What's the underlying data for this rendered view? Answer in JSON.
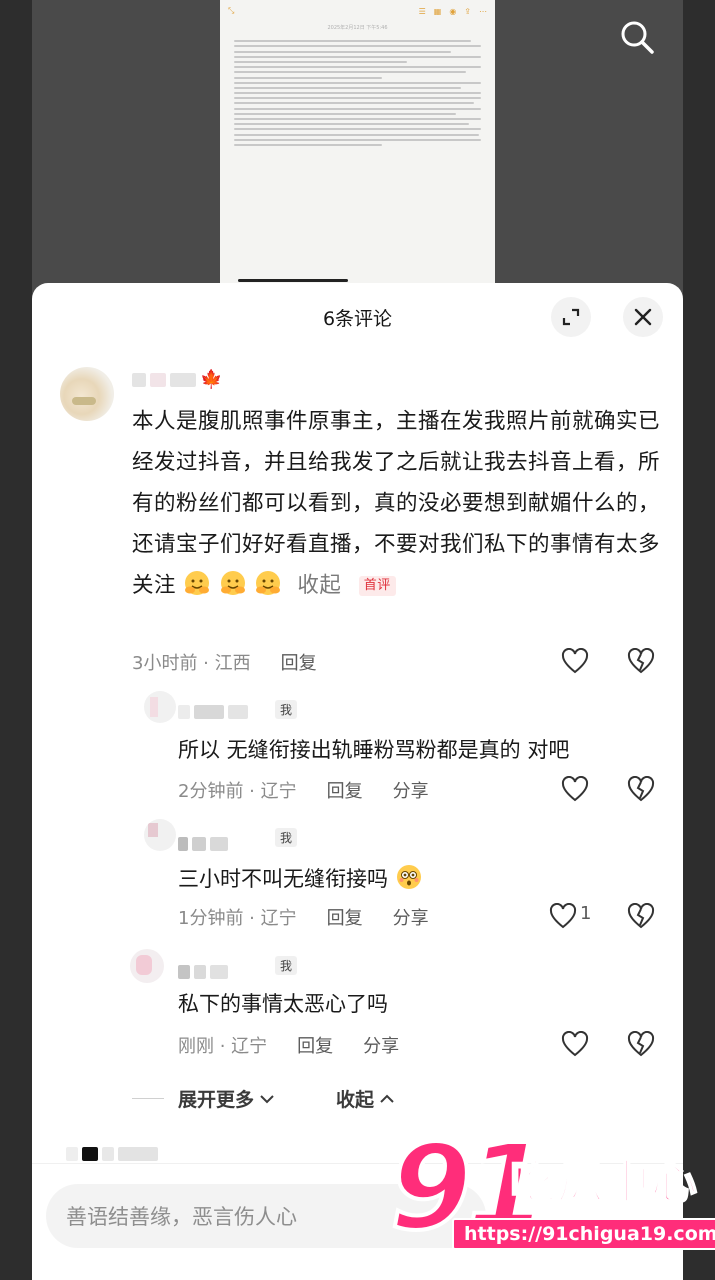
{
  "background": {
    "doc_date": "2025年2月12日 下午5:46"
  },
  "sheet": {
    "title": "6条评论"
  },
  "comments": {
    "main": {
      "text": "本人是腹肌照事件原事主，主播在发我照片前就确实已经发过抖音，并且给我发了之后就让我去抖音上看，所有的粉丝们都可以看到，真的没必要想到献媚什么的，还请宝子们好好看直播，不要对我们私下的事情有太多关注",
      "collapse": "收起",
      "badge": "首评",
      "time_loc": "3小时前 · 江西",
      "reply_label": "回复"
    },
    "replies": [
      {
        "me_label": "我",
        "text": "所以 无缝衔接出轨睡粉骂粉都是真的 对吧",
        "time_loc": "2分钟前 · 辽宁",
        "reply_label": "回复",
        "share_label": "分享",
        "likes": ""
      },
      {
        "me_label": "我",
        "text": "三小时不叫无缝衔接吗",
        "time_loc": "1分钟前 · 辽宁",
        "reply_label": "回复",
        "share_label": "分享",
        "likes": "1"
      },
      {
        "me_label": "我",
        "text": "私下的事情太恶心了吗",
        "time_loc": "刚刚 · 辽宁",
        "reply_label": "回复",
        "share_label": "分享",
        "likes": ""
      }
    ],
    "expand_more": "展开更多",
    "collapse_all": "收起"
  },
  "input": {
    "placeholder": "善语结善缘，恶言伤人心"
  },
  "watermark": {
    "number": "91",
    "brand": "吃瓜中心",
    "url": "https://91chigua19.com"
  },
  "colors": {
    "accent_red": "#e0313c",
    "watermark_pink": "#ff2d7a"
  },
  "icons": [
    "search-icon",
    "expand-icon",
    "close-icon",
    "heart-icon",
    "broken-heart-icon",
    "chevron-down-icon",
    "chevron-up-icon",
    "hug-emoji-icon",
    "flushed-emoji-icon",
    "maple-leaf-icon"
  ]
}
